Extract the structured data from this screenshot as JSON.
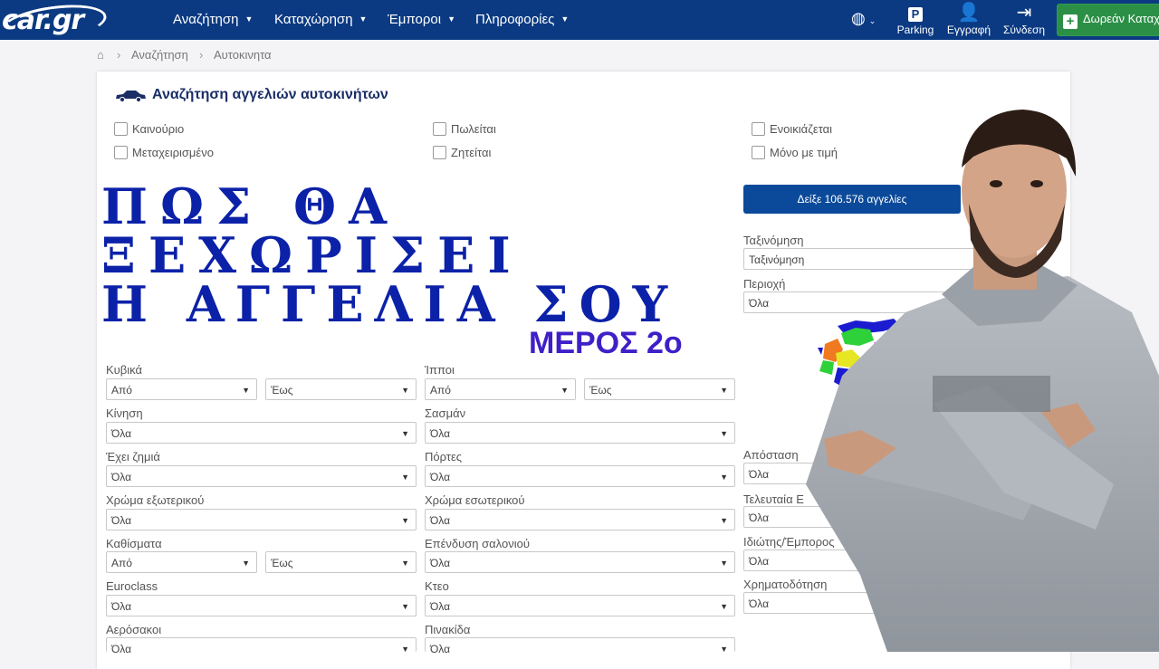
{
  "brand": {
    "logo_text": "car.gr"
  },
  "nav": {
    "items": [
      "Αναζήτηση",
      "Καταχώρηση",
      "Έμποροι",
      "Πληροφορίες"
    ],
    "parking": "Parking",
    "register": "Εγγραφή",
    "login": "Σύνδεση",
    "free_listing": "Δωρεάν Καταχ"
  },
  "breadcrumb": {
    "search": "Αναζήτηση",
    "cars": "Αυτοκινητα"
  },
  "search": {
    "title": "Αναζήτηση αγγελιών αυτοκινήτων",
    "checkboxes": {
      "new": "Καινούριο",
      "used": "Μεταχειρισμένο",
      "for_sale": "Πωλείται",
      "wanted": "Ζητείται",
      "for_rent": "Ενοικιάζεται",
      "with_price": "Μόνο με τιμή"
    },
    "show_button": "Δείξε 106.576 αγγελίες",
    "sort_label": "Ταξινόμηση",
    "sort_value": "Ταξινόμηση",
    "region_label": "Περιοχή",
    "region_value": "Όλα",
    "distance_label": "Απόσταση",
    "distance_value": "Όλα",
    "latest_label": "Τελευταία Ε",
    "latest_value": "Όλα",
    "seller_label": "Ιδιώτης/Έμπορος",
    "seller_value": "Όλα",
    "financing_label": "Χρηματοδότηση",
    "financing_value": "Όλα",
    "from": "Από",
    "to": "Έως",
    "all": "Όλα",
    "fields": {
      "cc": "Κυβικά",
      "hp": "Ίπποι",
      "drive": "Κίνηση",
      "chassis": "Σασμάν",
      "damage": "Έχει ζημιά",
      "doors": "Πόρτες",
      "ext_color": "Χρώμα εξωτερικού",
      "int_color": "Χρώμα εσωτερικού",
      "seats": "Καθίσματα",
      "upholstery": "Επένδυση σαλονιού",
      "euroclass": "Euroclass",
      "kteo": "Κτεο",
      "airbags": "Αερόσακοι",
      "plate": "Πινακίδα"
    }
  },
  "overlay": {
    "line1": "ΠΩΣ ΘΑ",
    "line2": "ΞΕΧΩΡΙΣΕΙ",
    "line3": "Η ΑΓΓΕΛΙΑ ΣΟΥ",
    "part": "ΜΕΡΟΣ 2ο"
  },
  "colors": {
    "nav": "#0b3a82",
    "button": "#0b4a9a",
    "overlay_text": "#0b21a8",
    "part_text": "#3f1fc8"
  }
}
